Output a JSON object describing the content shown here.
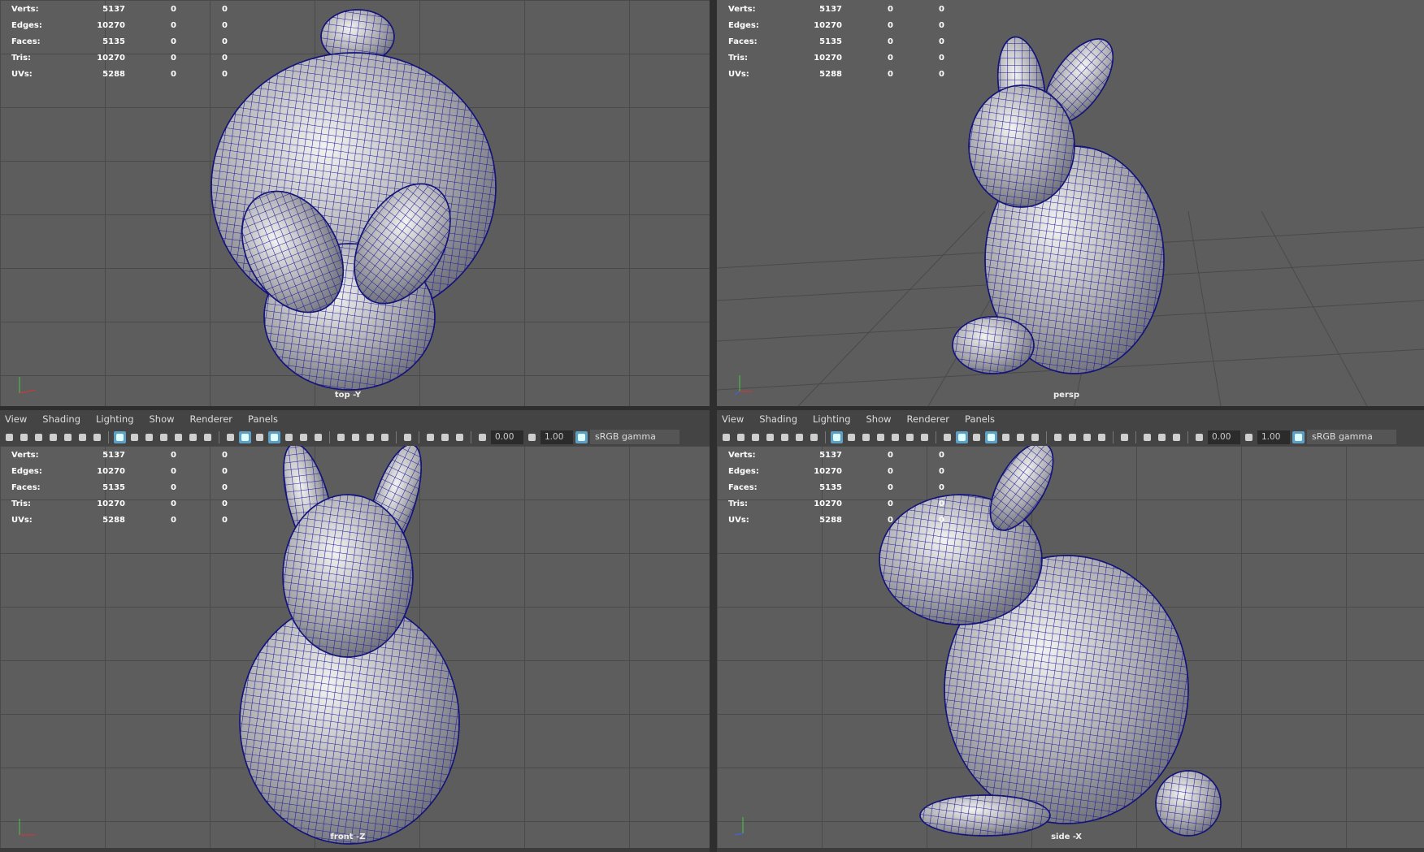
{
  "stats_labels": [
    "Verts:",
    "Edges:",
    "Faces:",
    "Tris:",
    "UVs:"
  ],
  "stats_values": [
    [
      "5137",
      "0",
      "0"
    ],
    [
      "10270",
      "0",
      "0"
    ],
    [
      "5135",
      "0",
      "0"
    ],
    [
      "10270",
      "0",
      "0"
    ],
    [
      "5288",
      "0",
      "0"
    ]
  ],
  "viewports": [
    {
      "camera": "top -Y"
    },
    {
      "camera": "persp"
    },
    {
      "camera": "front -Z"
    },
    {
      "camera": "side -X"
    }
  ],
  "menu": [
    "View",
    "Shading",
    "Lighting",
    "Show",
    "Renderer",
    "Panels"
  ],
  "toolbar": {
    "exposure": "0.00",
    "gamma": "1.00",
    "color_space": "sRGB gamma"
  },
  "colors": {
    "wire": "#1a1a8c",
    "highlight": "#5e9fc4"
  }
}
